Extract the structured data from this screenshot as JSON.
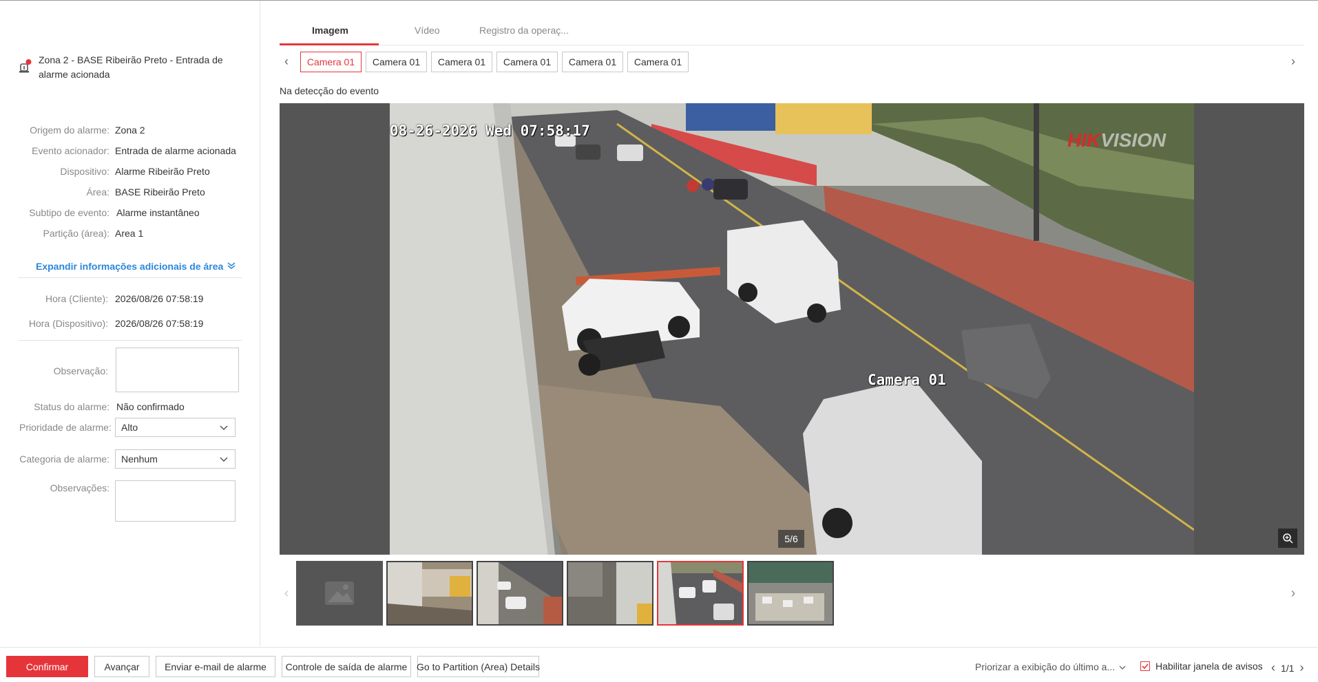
{
  "alarm": {
    "title": "Zona 2 - BASE Ribeirão Preto - Entrada de alarme acionada",
    "details": [
      {
        "label": "Origem do alarme:",
        "value": "Zona 2"
      },
      {
        "label": "Evento acionador:",
        "value": "Entrada de alarme acionada"
      },
      {
        "label": "Dispositivo:",
        "value": "Alarme Ribeirão Preto"
      },
      {
        "label": "Área:",
        "value": "BASE Ribeirão Preto"
      },
      {
        "label": "Subtipo de evento:",
        "value": "Alarme instantâneo"
      },
      {
        "label": "Partição (área):",
        "value": "Area 1"
      }
    ],
    "expand_label": "Expandir informações adicionais de área",
    "times": [
      {
        "label": "Hora (Cliente):",
        "value": "2026/08/26 07:58:19"
      },
      {
        "label": "Hora (Dispositivo):",
        "value": "2026/08/26 07:58:19"
      }
    ]
  },
  "form": {
    "observacao_label": "Observação:",
    "status_label": "Status do alarme:",
    "status_value": "Não confirmado",
    "prioridade_label": "Prioridade de alarme:",
    "prioridade_value": "Alto",
    "categoria_label": "Categoria de alarme:",
    "categoria_value": "Nenhum",
    "observacoes_label": "Observações:"
  },
  "tabs": [
    {
      "label": "Imagem"
    },
    {
      "label": "Vídeo"
    },
    {
      "label": "Registro da operaç..."
    }
  ],
  "cameras": [
    "Camera 01",
    "Camera 01",
    "Camera 01",
    "Camera 01",
    "Camera 01",
    "Camera 01"
  ],
  "viewer": {
    "caption": "Na detecção do evento",
    "osd_datetime": "08-26-2026 Wed 07:58:17",
    "osd_camera": "Camera 01",
    "brand_a": "HIK",
    "brand_b": "VISION",
    "counter": "5/6"
  },
  "bottom": {
    "confirm": "Confirmar",
    "next": "Avançar",
    "email": "Enviar e-mail de alarme",
    "output": "Controle de saída de alarme",
    "partition": "Go to Partition (Area) Details",
    "priority_select": "Priorizar a exibição do último a...",
    "enable_popup": "Habilitar janela de avisos",
    "page": "1/1"
  },
  "colors": {
    "accent": "#e6353a",
    "link": "#2b86dd"
  }
}
